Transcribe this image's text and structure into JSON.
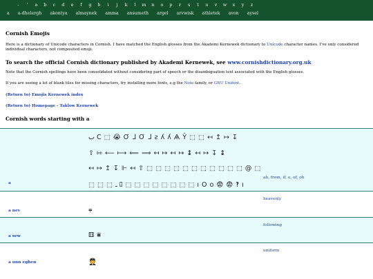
{
  "nav": {
    "letters": [
      "-",
      "'",
      "a",
      "b",
      "c",
      "d",
      "e",
      "f",
      "g",
      "h",
      "i",
      "j",
      "k",
      "l",
      "m",
      "n",
      "o",
      "p",
      "r",
      "s",
      "t",
      "u",
      "v",
      "w",
      "x",
      "y",
      "z"
    ],
    "words": [
      "a",
      "a-dhelergh",
      "akontya",
      "almaynek",
      "amma",
      "ansumeth",
      "argel",
      "arvwisk",
      "athletek",
      "avon",
      "aysel"
    ]
  },
  "page": {
    "title": "Cornish Emojis",
    "intro_before": "Here is a dictionary of Unicode characters in Cornish. I have matched the English glosses from the Akademi Kernewek dictionary to ",
    "intro_link": "Unicode",
    "intro_after": " character names. I've only considered individual characters, not composited emoji.",
    "search_heading": "To search the official Cornish dictionary published by Akademi Kernewek, see ",
    "search_link": "www.cornishdictionary.org.uk",
    "note1": "Note that the Cornish spellings have been consolidated without considering part of speech or the disambiguation text associated with the English glosses.",
    "note2_before": "If you are seeing a lot of blank tiles for missing characters, try installing more fonts, e.g the ",
    "note2_link1": "Noto",
    "note2_mid": " family, or ",
    "note2_link2": "GNU Unifont",
    "note2_after": ".",
    "return1": "(Return to) Emojis Kernewek index",
    "return2": "(Return to) Homepage - Taklow Kernewek",
    "words_heading": "Cornish words starting with a"
  },
  "entries": [
    {
      "word": "a",
      "gloss": "ah, from, if, o, of, oh",
      "lines": [
        [
          "ب",
          "Ϲ",
          "⬚",
          "😭",
          "Ơ",
          "ᒧ",
          "Ơ",
          "ᒧ",
          "ꙅ",
          "ʎ",
          "ʎ",
          "Ѧ",
          "Ŷ",
          "⬚",
          "⬚",
          "↤",
          "↥",
          "↦",
          "↧"
        ],
        [
          "⇧",
          "⇰",
          "⟵",
          "⟼",
          "⟸",
          "⟹",
          "↤",
          "↦",
          "↤",
          "↦",
          "↨",
          "↤",
          "↦",
          "↧",
          "↨"
        ],
        [
          "↤",
          "↦",
          "↥",
          "↧",
          "⊩",
          "↤",
          "⇧",
          "⬚",
          "⬚",
          "⬚",
          "⬚",
          "⬚",
          "⬚",
          "⬚",
          "⬚",
          "⬚",
          "⬚",
          "⬚",
          "@",
          "⬚"
        ],
        [
          "⬚",
          "⬚",
          "⬚",
          "ـ",
          "ﾛ",
          "⬚",
          "⬚",
          "⬚",
          "⬚",
          "⬚",
          "⬚",
          "⬚",
          "⬚",
          "ı",
          "O",
          "o",
          "😨",
          "😨",
          "‽",
          "ı"
        ]
      ]
    },
    {
      "word": "a nev",
      "gloss": "heavenly",
      "lines": [
        [
          "⩦"
        ]
      ]
    },
    {
      "word": "a sew",
      "gloss": "following",
      "lines": [
        [
          "⚅",
          "⩸"
        ]
      ]
    },
    {
      "word": "a unn eghen",
      "gloss": "uniform",
      "lines": [
        [
          "🧑‍✈"
        ]
      ]
    }
  ]
}
